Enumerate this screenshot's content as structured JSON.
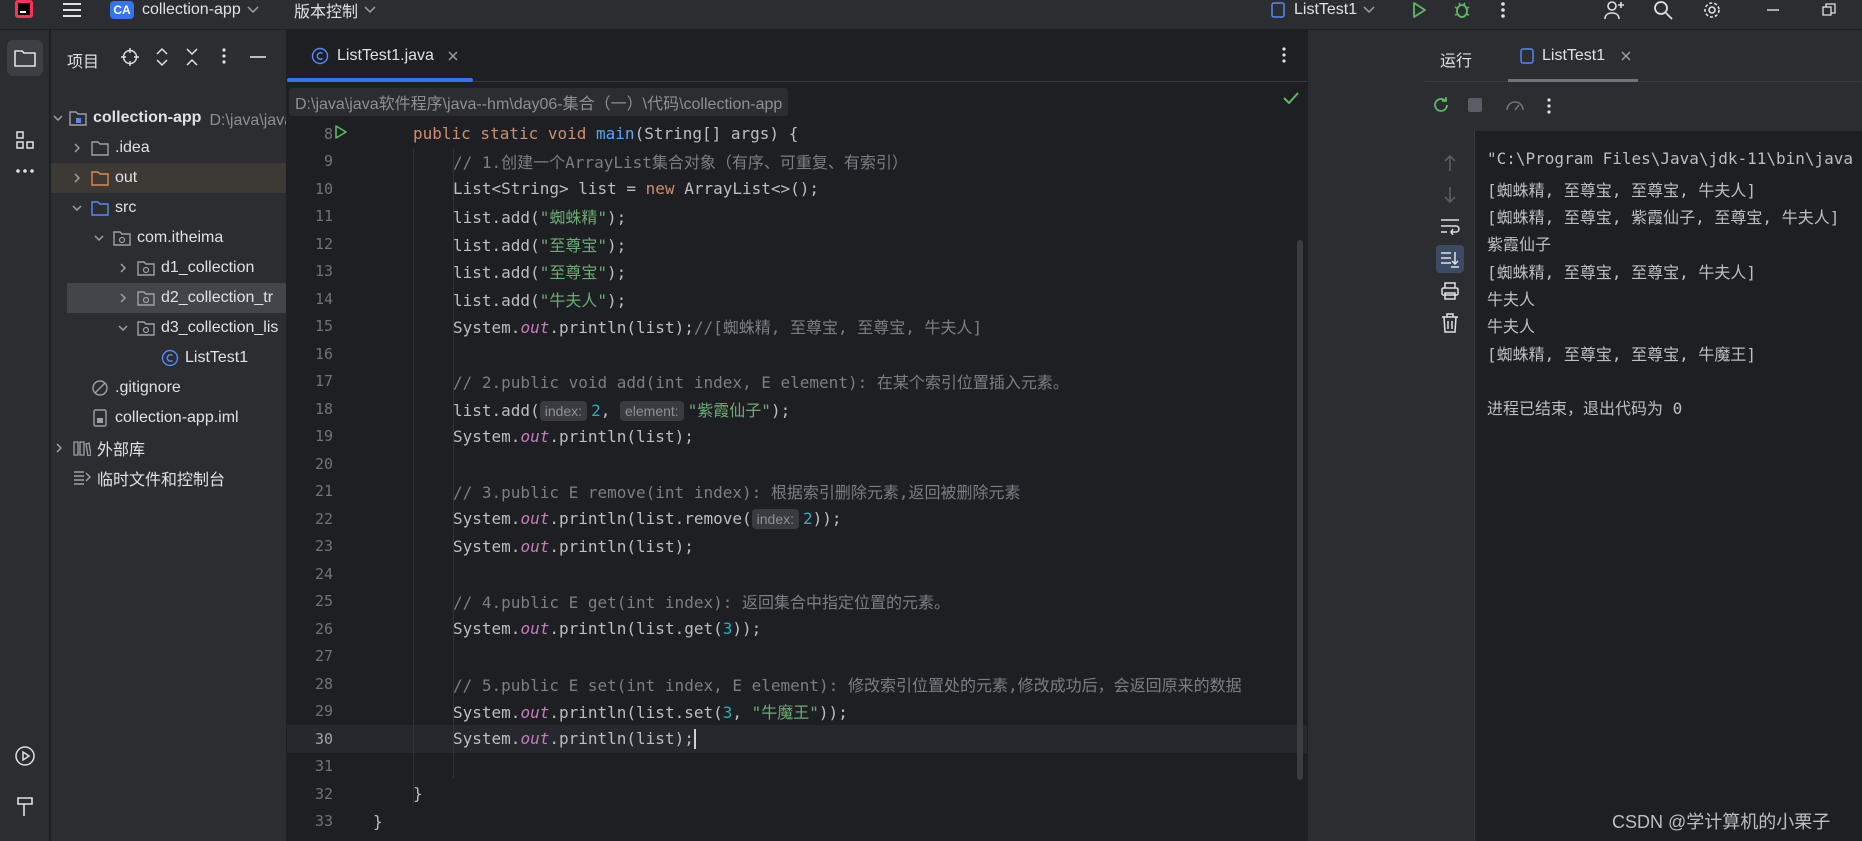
{
  "titlebar": {
    "project_badge": "CA",
    "project_name": "collection-app",
    "vcs_menu": "版本控制",
    "run_config": "ListTest1"
  },
  "project_panel": {
    "title": "项目",
    "root": {
      "name": "collection-app",
      "path": "D:\\java\\java软件程序\\java--hm\\day06-集合（一）\\代码\\collection-app"
    },
    "items": [
      {
        "label": ".idea",
        "kind": "folder"
      },
      {
        "label": "out",
        "kind": "folder-excluded"
      },
      {
        "label": "src",
        "kind": "folder-source"
      },
      {
        "label": "com.itheima",
        "kind": "package"
      },
      {
        "label": "d1_collection",
        "kind": "package"
      },
      {
        "label": "d2_collection_tr",
        "kind": "package"
      },
      {
        "label": "d3_collection_lis",
        "kind": "package"
      },
      {
        "label": "ListTest1",
        "kind": "java-class"
      },
      {
        "label": ".gitignore",
        "kind": "file"
      },
      {
        "label": "collection-app.iml",
        "kind": "file"
      },
      {
        "label": "外部库",
        "kind": "library"
      },
      {
        "label": "临时文件和控制台",
        "kind": "scratch"
      }
    ]
  },
  "editor": {
    "tab_label": "ListTest1.java",
    "lines": [
      {
        "n": "8"
      },
      {
        "n": "9"
      },
      {
        "n": "10"
      },
      {
        "n": "11"
      },
      {
        "n": "12"
      },
      {
        "n": "13"
      },
      {
        "n": "14"
      },
      {
        "n": "15"
      },
      {
        "n": "16"
      },
      {
        "n": "17"
      },
      {
        "n": "18"
      },
      {
        "n": "19"
      },
      {
        "n": "20"
      },
      {
        "n": "21"
      },
      {
        "n": "22"
      },
      {
        "n": "23"
      },
      {
        "n": "24"
      },
      {
        "n": "25"
      },
      {
        "n": "26"
      },
      {
        "n": "27"
      },
      {
        "n": "28"
      },
      {
        "n": "29"
      },
      {
        "n": "30"
      },
      {
        "n": "31"
      },
      {
        "n": "32"
      },
      {
        "n": "33"
      }
    ],
    "code": {
      "l8_kw": "public static void ",
      "l8_fn": "main",
      "l8_rest": "(String[] args) {",
      "l9": "// 1.创建一个ArrayList集合对象（有序、可重复、有索引）",
      "l10_a": "List<String> list = ",
      "l10_kw": "new",
      "l10_b": " ArrayList<>();",
      "l11_a": "list.add(",
      "l11_s": "\"蜘蛛精\"",
      "l11_b": ");",
      "l12_a": "list.add(",
      "l12_s": "\"至尊宝\"",
      "l12_b": ");",
      "l13_a": "list.add(",
      "l13_s": "\"至尊宝\"",
      "l13_b": ");",
      "l14_a": "list.add(",
      "l14_s": "\"牛夫人\"",
      "l14_b": ");",
      "l15_a": "System.",
      "l15_f": "out",
      "l15_b": ".println(list);",
      "l15_c": "//[蜘蛛精, 至尊宝, 至尊宝, 牛夫人]",
      "l17": "// 2.public void add(int index, E element): 在某个索引位置插入元素。",
      "l18_a": "list.add(",
      "l18_h1": "index:",
      "l18_n": "2",
      "l18_comma": ", ",
      "l18_h2": "element:",
      "l18_s": "\"紫霞仙子\"",
      "l18_b": ");",
      "l19_a": "System.",
      "l19_f": "out",
      "l19_b": ".println(list);",
      "l21": "// 3.public E remove(int index): 根据索引删除元素,返回被删除元素",
      "l22_a": "System.",
      "l22_f": "out",
      "l22_b": ".println(list.remove(",
      "l22_h": "index:",
      "l22_n": "2",
      "l22_c": "));",
      "l23_a": "System.",
      "l23_f": "out",
      "l23_b": ".println(list);",
      "l25": "// 4.public E get(int index): 返回集合中指定位置的元素。",
      "l26_a": "System.",
      "l26_f": "out",
      "l26_b": ".println(list.get(",
      "l26_n": "3",
      "l26_c": "));",
      "l28": "// 5.public E set(int index, E element): 修改索引位置处的元素,修改成功后，会返回原来的数据",
      "l29_a": "System.",
      "l29_f": "out",
      "l29_b": ".println(list.set(",
      "l29_n": "3",
      "l29_comma": ", ",
      "l29_s": "\"牛魔王\"",
      "l29_c": "));",
      "l30_a": "System.",
      "l30_f": "out",
      "l30_b": ".println(list);",
      "l32": "}",
      "l33": "}"
    }
  },
  "run_panel": {
    "tab_run": "运行",
    "tab_config": "ListTest1",
    "output": [
      "\"C:\\Program Files\\Java\\jdk-11\\bin\\java",
      "[蜘蛛精, 至尊宝, 至尊宝, 牛夫人]",
      "[蜘蛛精, 至尊宝, 紫霞仙子, 至尊宝, 牛夫人]",
      "紫霞仙子",
      "[蜘蛛精, 至尊宝, 至尊宝, 牛夫人]",
      "牛夫人",
      "牛夫人",
      "[蜘蛛精, 至尊宝, 至尊宝, 牛魔王]",
      "",
      "进程已结束，退出代码为 0"
    ]
  },
  "watermark": "CSDN @学计算机的小栗子",
  "colors": {
    "accent": "#3574f0",
    "keyword": "#cf8e6d",
    "string": "#6aab73",
    "number": "#2aacb8",
    "comment": "#7a7e85",
    "field": "#c77dbb",
    "run_green": "#5fb865"
  }
}
